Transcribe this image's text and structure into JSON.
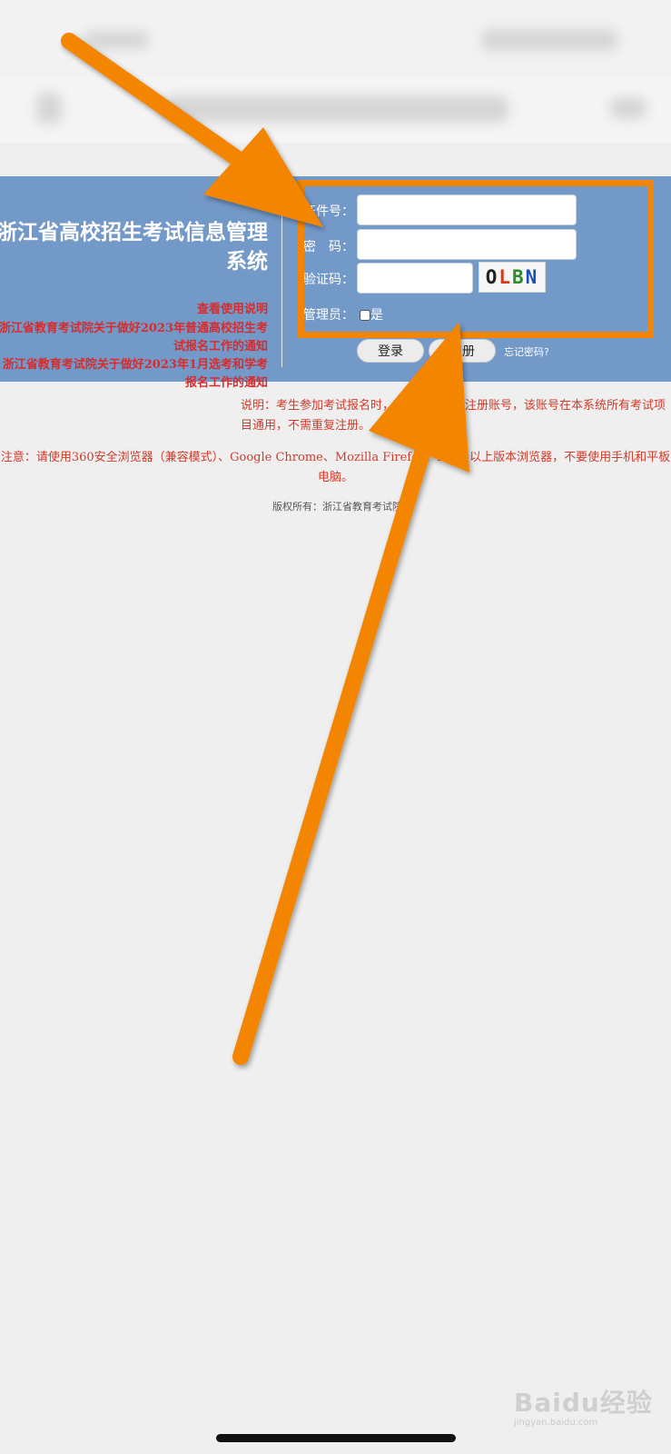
{
  "system": {
    "title": "浙江省高校招生考试信息管理系统",
    "links": [
      "查看使用说明",
      "浙江省教育考试院关于做好2023年普通高校招生考试报名工作的通知",
      "浙江省教育考试院关于做好2023年1月选考和学考报名工作的通知"
    ]
  },
  "login_form": {
    "id_label": "证件号：",
    "password_label": "密　码：",
    "captcha_label": "验证码：",
    "admin_label": "管理员：",
    "admin_option": "是",
    "captcha_text": [
      "O",
      "L",
      "B",
      "N"
    ],
    "login_button": "登录",
    "register_button": "注册",
    "forgot_password": "忘记密码?"
  },
  "info": {
    "note": "说明：考生参加考试报名时，请以有效证件注册账号，该账号在本系统所有考试项目通用，不需重复注册。",
    "warning": "注意：请使用360安全浏览器（兼容模式）、Google Chrome、Mozilla Firefox、IE9及以上版本浏览器，不要使用手机和平板电脑。",
    "copyright": "版权所有：浙江省教育考试院"
  },
  "watermark": {
    "brand": "Baidu经验",
    "url": "jingyan.baidu.com"
  },
  "colors": {
    "banner": "#7399c9",
    "highlight": "#f38506",
    "notice_red": "#d62c2c"
  }
}
